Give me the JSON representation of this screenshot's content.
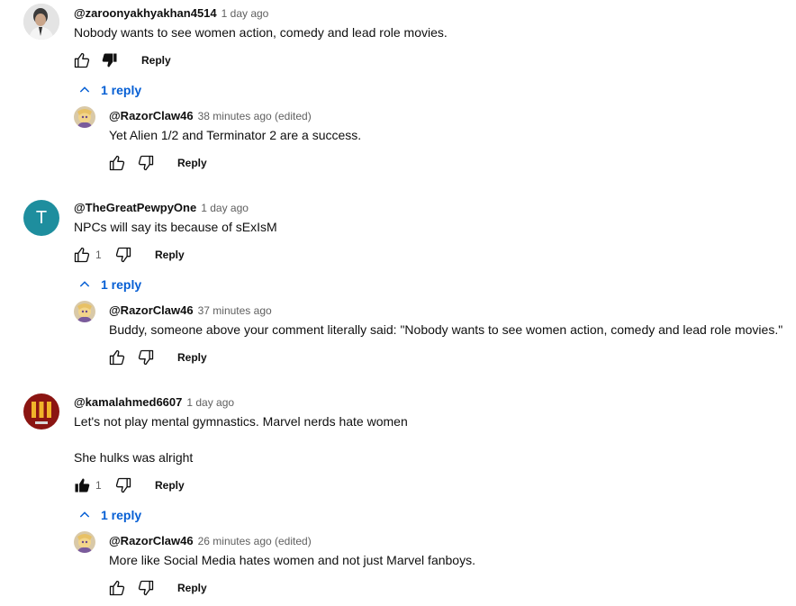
{
  "comments": [
    {
      "handle": "@zaroonyakhyakhan4514",
      "time": "1 day ago",
      "text": "Nobody wants to see women action, comedy and lead role movies.",
      "likes": "",
      "reply_label": "Reply",
      "replies_toggle": "1 reply",
      "reply": {
        "handle": "@RazorClaw46",
        "time": "38 minutes ago (edited)",
        "text": "Yet Alien 1/2 and Terminator 2 are a success.",
        "reply_label": "Reply"
      }
    },
    {
      "handle": "@TheGreatPewpyOne",
      "time": "1 day ago",
      "avatar_letter": "T",
      "text": "NPCs will say its because of sExIsM",
      "likes": "1",
      "reply_label": "Reply",
      "replies_toggle": "1 reply",
      "reply": {
        "handle": "@RazorClaw46",
        "time": "37 minutes ago",
        "text": "Buddy, someone above your comment literally said: \"Nobody wants to see women action, comedy and lead role movies.\"",
        "reply_label": "Reply"
      }
    },
    {
      "handle": "@kamalahmed6607",
      "time": "1 day ago",
      "text_line1": "Let's not play mental gymnastics. Marvel nerds hate women",
      "text_line2": "She hulks was alright",
      "likes": "1",
      "reply_label": "Reply",
      "replies_toggle": "1 reply",
      "reply": {
        "handle": "@RazorClaw46",
        "time": "26 minutes ago (edited)",
        "text": "More like Social Media hates women and not just Marvel fanboys.",
        "reply_label": "Reply"
      }
    }
  ],
  "colors": {
    "link_blue": "#065fd4",
    "teal_avatar": "#1e8e9e",
    "text": "#0f0f0f",
    "meta": "#606060"
  },
  "icons": [
    "like-icon",
    "dislike-icon",
    "chevron-up-icon"
  ]
}
